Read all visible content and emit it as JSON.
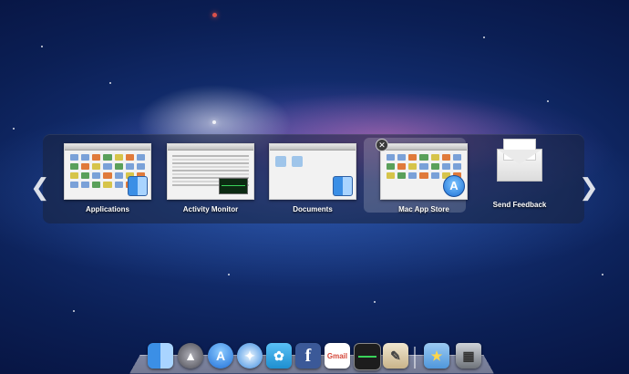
{
  "switcher": {
    "items": [
      {
        "label": "Applications"
      },
      {
        "label": "Activity Monitor"
      },
      {
        "label": "Documents"
      },
      {
        "label": "Mac App Store",
        "selected": true
      },
      {
        "label": "Send Feedback"
      }
    ],
    "prev_icon": "chevron-left-icon",
    "next_icon": "chevron-right-icon"
  },
  "dock": {
    "items": [
      {
        "name": "finder-icon",
        "color": "#3b8fe6"
      },
      {
        "name": "launchpad-icon",
        "color": "#6c6c74"
      },
      {
        "name": "app-store-icon",
        "color": "#1f7fe0"
      },
      {
        "name": "safari-icon",
        "color": "#3a9be8"
      },
      {
        "name": "twitter-icon",
        "color": "#2fa3e6"
      },
      {
        "name": "facebook-icon",
        "color": "#3b5998"
      },
      {
        "name": "gmail-icon",
        "color": "#d44638"
      },
      {
        "name": "activity-monitor-icon",
        "color": "#1d1d1d"
      },
      {
        "name": "preview-icon",
        "color": "#c9b48a"
      },
      {
        "name": "favorites-folder-icon",
        "color": "#5da4e6"
      },
      {
        "name": "trash-icon",
        "color": "#8a8f96"
      }
    ],
    "gmail_text": "Gmail",
    "facebook_text": "f",
    "app_store_text": "A"
  }
}
